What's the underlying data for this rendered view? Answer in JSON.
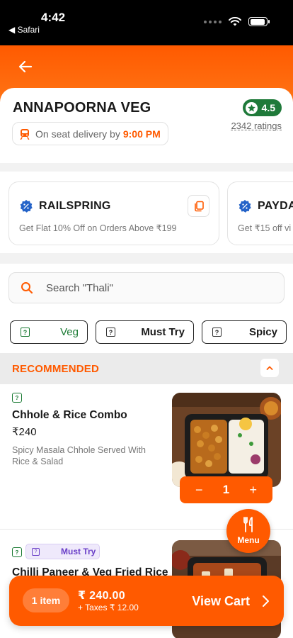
{
  "status_bar": {
    "time": "4:42",
    "back_app": "◀ Safari",
    "battery_level": 0.92
  },
  "restaurant": {
    "name": "ANNAPOORNA VEG",
    "rating": "4.5",
    "ratings_count": "2342 ratings",
    "delivery_prefix": "On seat delivery by",
    "delivery_time": "9:00 PM"
  },
  "offers": [
    {
      "code": "RAILSPRING",
      "desc": "Get Flat 10% Off on Orders Above ₹199"
    },
    {
      "code": "PAYDA",
      "desc": "Get ₹15 off vi"
    }
  ],
  "search": {
    "placeholder": "Search \"Thali\""
  },
  "filters": [
    {
      "label": "Veg"
    },
    {
      "label": "Must Try"
    },
    {
      "label": "Spicy"
    }
  ],
  "section": {
    "title": "RECOMMENDED"
  },
  "items": [
    {
      "name": "Chhole & Rice Combo",
      "price": "₹240",
      "desc": "Spicy Masala Chhole Served With Rice & Salad",
      "qty": "1",
      "minus": "−",
      "plus": "+"
    },
    {
      "name": "Chilli Paneer & Veg Fried Rice",
      "tag": "Must Try"
    }
  ],
  "menu_fab": {
    "label": "Menu"
  },
  "cart": {
    "count": "1 item",
    "total": "₹ 240.00",
    "taxes": "+ Taxes ₹ 12.00",
    "cta": "View Cart"
  },
  "colors": {
    "brand": "#ff5a00",
    "rating_green": "#1f7a3a",
    "veg_green": "#1a7a33",
    "tag_purple": "#6a3fc8"
  }
}
